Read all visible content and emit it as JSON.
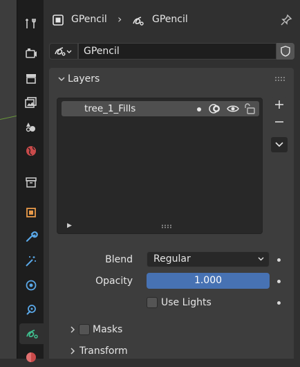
{
  "header": {
    "breadcrumb_object": "GPencil",
    "breadcrumb_data": "GPencil"
  },
  "datablock": {
    "name": "GPencil"
  },
  "layers": {
    "title": "Layers",
    "items": [
      {
        "name": "tree_1_Fills"
      }
    ]
  },
  "properties": {
    "blend_label": "Blend",
    "blend_value": "Regular",
    "opacity_label": "Opacity",
    "opacity_value": "1.000",
    "use_lights_label": "Use Lights"
  },
  "subpanels": {
    "masks": "Masks",
    "transform": "Transform"
  },
  "colors": {
    "accent": "#4772b3",
    "active_tab_icon": "#3fbf8f"
  },
  "icons": [
    "tool-icon",
    "render-icon",
    "output-icon",
    "view-layer-icon",
    "scene-icon",
    "world-icon",
    "collection-icon",
    "object-icon",
    "modifier-icon",
    "shader-fx-icon",
    "physics-icon",
    "constraint-icon",
    "gpencil-data-icon",
    "material-icon"
  ]
}
